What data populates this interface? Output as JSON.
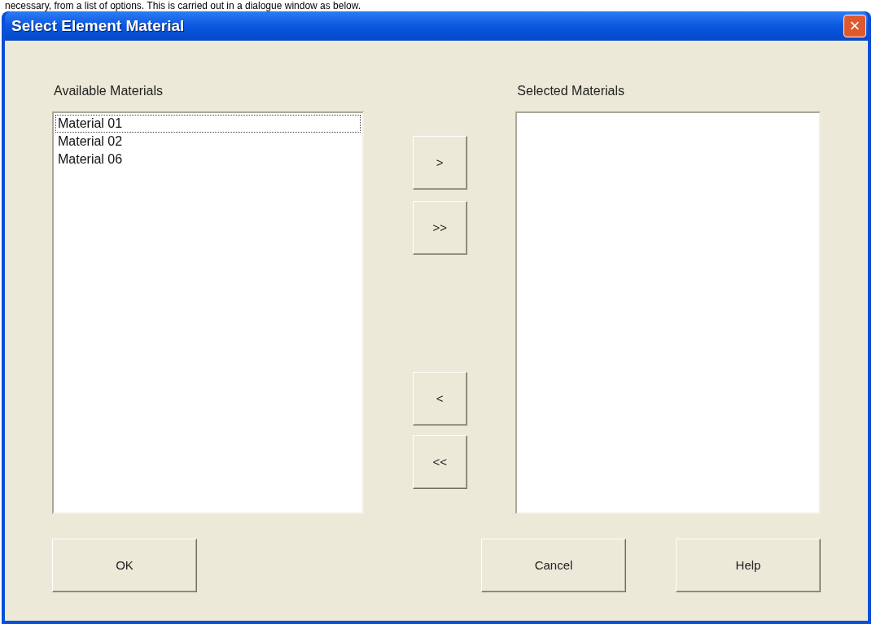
{
  "caption": "necessary, from a list of options. This is carried out in a dialogue window as below.",
  "window": {
    "title": "Select Element Material",
    "close": "×"
  },
  "available": {
    "label": "Available Materials",
    "items": [
      {
        "text": "Material 01",
        "focused": true
      },
      {
        "text": "Material 02",
        "focused": false
      },
      {
        "text": "Material 06",
        "focused": false
      }
    ]
  },
  "selected": {
    "label": "Selected Materials"
  },
  "move_buttons_top": [
    ">",
    ">>"
  ],
  "move_buttons_bottom": [
    "<",
    "<<"
  ],
  "buttons": [
    {
      "label": "OK",
      "kind": "left"
    },
    {
      "label": "Cancel",
      "kind": "right"
    },
    {
      "label": "Help",
      "kind": "right"
    }
  ]
}
